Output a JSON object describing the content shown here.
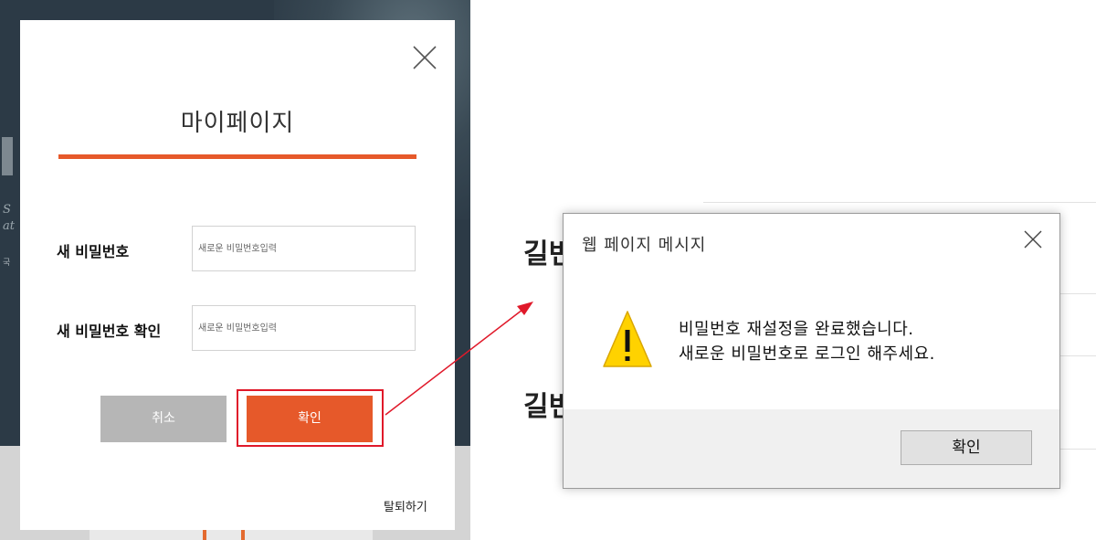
{
  "modal": {
    "title": "마이페이지",
    "new_password_label": "새 비밀번호",
    "new_password_placeholder": "새로운 비밀번호입력",
    "confirm_password_label": "새 비밀번호 확인",
    "confirm_password_placeholder": "새로운 비밀번호입력",
    "cancel_label": "취소",
    "confirm_label": "확인",
    "withdraw_label": "탈퇴하기"
  },
  "background_page": {
    "heading_1": "길번",
    "heading_2": "길번"
  },
  "dialog": {
    "title": "웹 페이지 메시지",
    "message_line_1": "비밀번호 재설정을 완료했습니다.",
    "message_line_2": "새로운 비밀번호로 로그인 해주세요.",
    "ok_label": "확인"
  },
  "colors": {
    "accent": "#e6592a",
    "highlight": "#e0192a",
    "cancel_button": "#b6b6b6"
  },
  "icons": {
    "modal_close": "close-icon",
    "dialog_close": "close-icon",
    "dialog_warning": "warning-icon"
  }
}
